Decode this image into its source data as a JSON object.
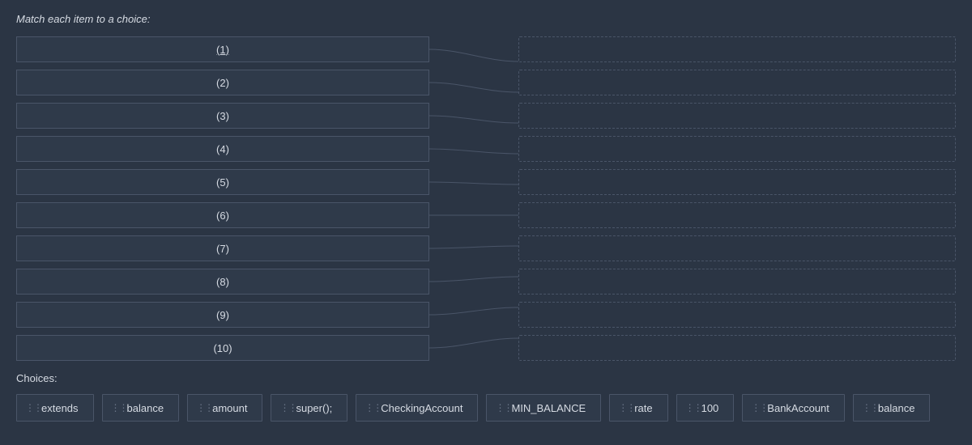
{
  "instruction": "Match each item to a choice:",
  "items": [
    {
      "label": "(1)"
    },
    {
      "label": "(2)"
    },
    {
      "label": "(3)"
    },
    {
      "label": "(4)"
    },
    {
      "label": "(5)"
    },
    {
      "label": "(6)"
    },
    {
      "label": "(7)"
    },
    {
      "label": "(8)"
    },
    {
      "label": "(9)"
    },
    {
      "label": "(10)"
    }
  ],
  "choices_label": "Choices:",
  "choices": [
    {
      "label": "extends"
    },
    {
      "label": "balance"
    },
    {
      "label": "amount"
    },
    {
      "label": "super();"
    },
    {
      "label": "CheckingAccount"
    },
    {
      "label": "MIN_BALANCE"
    },
    {
      "label": "rate"
    },
    {
      "label": "100"
    },
    {
      "label": "BankAccount"
    },
    {
      "label": "balance"
    }
  ]
}
